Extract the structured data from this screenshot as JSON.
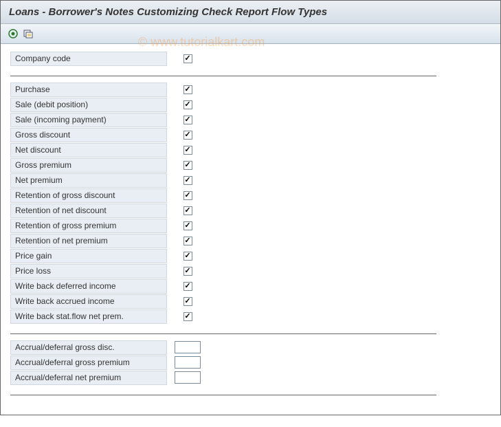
{
  "title": "Loans - Borrower's Notes Customizing Check Report Flow Types",
  "watermark": "© www.tutorialkart.com",
  "group1": [
    {
      "label": "Company code",
      "checked": true
    }
  ],
  "group2": [
    {
      "label": "Purchase",
      "checked": true
    },
    {
      "label": "Sale (debit position)",
      "checked": true
    },
    {
      "label": "Sale (incoming payment)",
      "checked": true
    },
    {
      "label": "Gross discount",
      "checked": true
    },
    {
      "label": "Net discount",
      "checked": true
    },
    {
      "label": "Gross premium",
      "checked": true
    },
    {
      "label": "Net premium",
      "checked": true
    },
    {
      "label": "Retention of gross discount",
      "checked": true
    },
    {
      "label": "Retention of net discount",
      "checked": true
    },
    {
      "label": "Retention of gross premium",
      "checked": true
    },
    {
      "label": "Retention of net premium",
      "checked": true
    },
    {
      "label": "Price gain",
      "checked": true
    },
    {
      "label": "Price loss",
      "checked": true
    },
    {
      "label": "Write back deferred income",
      "checked": true
    },
    {
      "label": "Write back accrued income",
      "checked": true
    },
    {
      "label": "Write back stat.flow net prem.",
      "checked": true
    }
  ],
  "group3": [
    {
      "label": "Accrual/deferral gross disc.",
      "value": ""
    },
    {
      "label": "Accrual/deferral gross premium",
      "value": ""
    },
    {
      "label": "Accrual/deferral net premium",
      "value": ""
    }
  ]
}
